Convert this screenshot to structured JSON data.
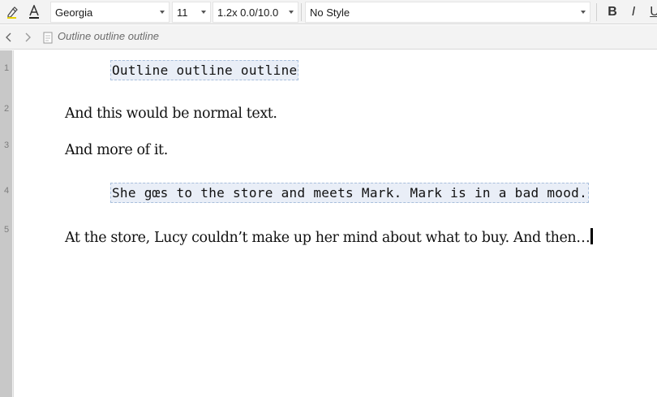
{
  "toolbar": {
    "font_family": "Georgia",
    "font_size": "11",
    "line_spacing": "1.2x 0.0/10.0",
    "paragraph_style": "No Style",
    "bold_label": "B",
    "italic_label": "I",
    "underline_label": "U",
    "icons": {
      "highlight": "highlighter-icon",
      "text_color": "text-color-icon"
    }
  },
  "navbar": {
    "breadcrumb": "Outline outline outline",
    "icons": {
      "back": "chevron-left-icon",
      "forward": "chevron-right-icon",
      "document": "document-icon"
    }
  },
  "editor": {
    "lines": [
      {
        "number": "1",
        "kind": "outline",
        "text": "Outline outline outline"
      },
      {
        "number": "2",
        "kind": "normal",
        "text": "And this would be normal text."
      },
      {
        "number": "3",
        "kind": "normal",
        "text": "And more of it."
      },
      {
        "number": "4",
        "kind": "outline",
        "text": "She gœs to the store and meets Mark. Mark is in a bad mood."
      },
      {
        "number": "5",
        "kind": "normal",
        "text": "At the store, Lucy couldn’t make up her mind about what to buy. And then…"
      }
    ]
  },
  "colors": {
    "toolbar_bg": "#f3f3f3",
    "outline_bg": "#e9eef7",
    "outline_border": "#a9bfdc",
    "text": "#111111"
  }
}
